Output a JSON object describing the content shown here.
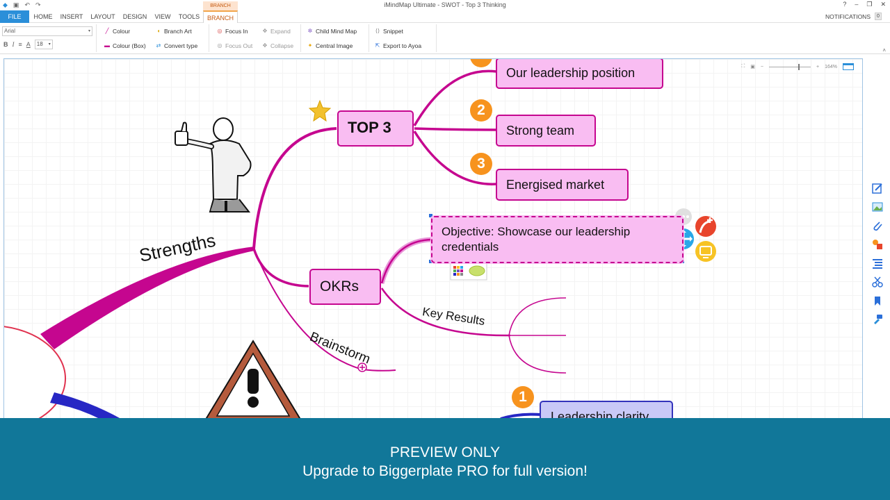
{
  "window": {
    "title": "iMindMap Ultimate - SWOT - Top 3 Thinking",
    "controls": [
      "?",
      "–",
      "❐",
      "✕"
    ]
  },
  "quick_access": [
    "save-icon",
    "undo-icon",
    "redo-icon"
  ],
  "ribbon_tabs": {
    "contextual_label": "BRANCH TOOLS",
    "items": [
      "FILE",
      "HOME",
      "INSERT",
      "LAYOUT",
      "DESIGN",
      "VIEW",
      "TOOLS",
      "BRANCH"
    ],
    "active": "BRANCH"
  },
  "notifications": {
    "label": "NOTIFICATIONS",
    "count": "0"
  },
  "ribbon": {
    "font_name": "Arial",
    "font_size": "18",
    "format_buttons": [
      "B",
      "I",
      "≡",
      "A"
    ],
    "buttons": {
      "colour": "Colour",
      "colour_box": "Colour (Box)",
      "branch_art": "Branch Art",
      "convert_type": "Convert type",
      "focus_in": "Focus In",
      "focus_out": "Focus Out",
      "expand": "Expand",
      "collapse": "Collapse",
      "child_mind_map": "Child Mind Map",
      "central_image": "Central Image",
      "snippet": "Snippet",
      "export_ayoa": "Export to Ayoa"
    }
  },
  "canvas": {
    "zoom_level": "164%",
    "branches": {
      "strengths": "Strengths",
      "top3": "TOP 3",
      "okrs": "OKRs",
      "brainstorm": "Brainstorm",
      "key_results": "Key Results"
    },
    "nodes": {
      "leadership_position": "Our leadership position",
      "strong_team": "Strong team",
      "energised_market": "Energised market",
      "objective": "Objective: Showcase our leadership credentials",
      "leadership_clarity": "Leadership clarity"
    },
    "badges": [
      "2",
      "3",
      "1"
    ],
    "colors": {
      "branch_magenta": "#c5068f",
      "node_fill": "#f9bdf2",
      "badge_orange": "#f7931e",
      "blue_branch": "#2727c4"
    }
  },
  "banner": {
    "line1": "PREVIEW ONLY",
    "line2": "Upgrade to Biggerplate PRO for full version!"
  }
}
